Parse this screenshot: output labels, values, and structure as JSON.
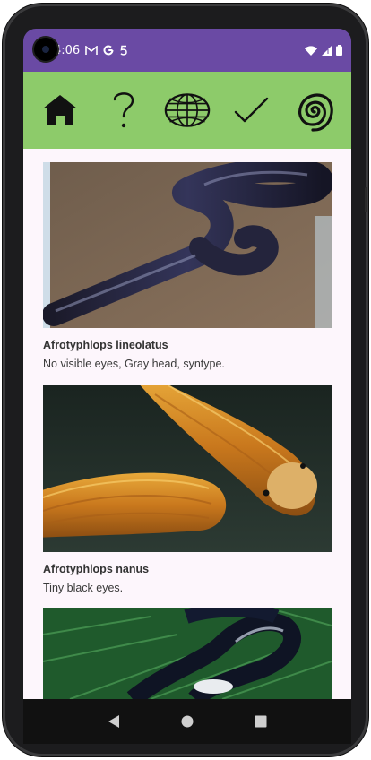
{
  "status_bar": {
    "time": "4:06",
    "notification_icons": [
      "gmail-icon",
      "google-icon",
      "five-icon"
    ],
    "system_icons": [
      "wifi-icon",
      "cell-signal-icon",
      "battery-icon"
    ],
    "background_color": "#6a4aa4"
  },
  "app_bar": {
    "background_color": "#8dcb6a",
    "icons": [
      "home-icon",
      "question-icon",
      "globe-icon",
      "checkmark-icon",
      "spiral-icon"
    ]
  },
  "cards": [
    {
      "title": "Afrotyphlops lineolatus",
      "description": "No visible eyes, Gray head, syntype."
    },
    {
      "title": "Afrotyphlops nanus",
      "description": "Tiny black eyes."
    }
  ],
  "nav_bar": {
    "buttons": [
      "back-icon",
      "home-circle-icon",
      "recents-icon"
    ]
  }
}
